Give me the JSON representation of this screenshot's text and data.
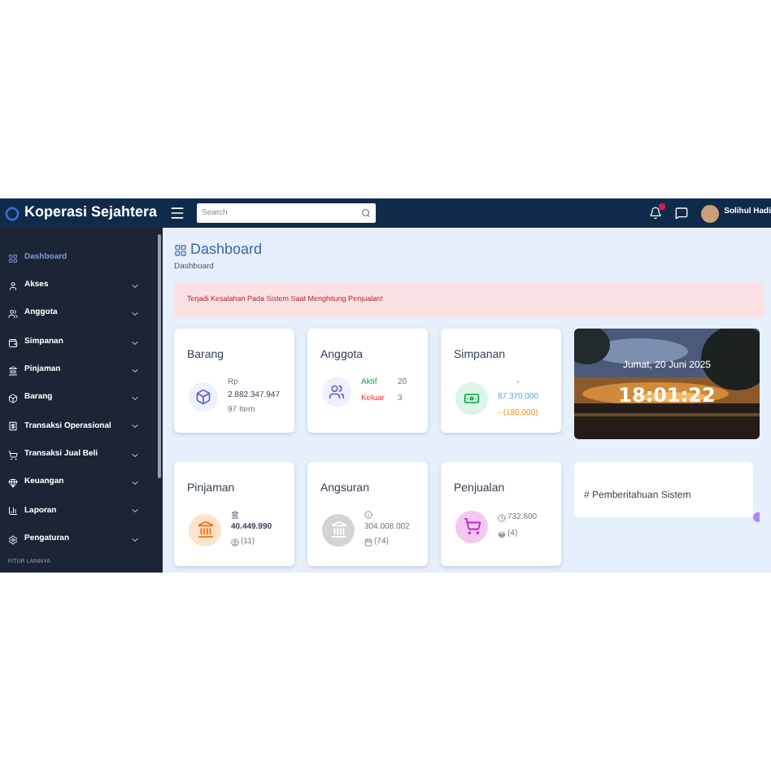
{
  "brand": "Koperasi Sejahtera",
  "search": {
    "placeholder": "Search"
  },
  "user": {
    "name": "Solihul Hadi"
  },
  "sidebar": {
    "items": [
      {
        "label": "Dashboard",
        "selected": true,
        "expandable": false
      },
      {
        "label": "Akses",
        "selected": false,
        "expandable": true
      },
      {
        "label": "Anggota",
        "selected": false,
        "expandable": true
      },
      {
        "label": "Simpanan",
        "selected": false,
        "expandable": true
      },
      {
        "label": "Pinjaman",
        "selected": false,
        "expandable": true
      },
      {
        "label": "Barang",
        "selected": false,
        "expandable": true
      },
      {
        "label": "Transaksi Operasional",
        "selected": false,
        "expandable": true
      },
      {
        "label": "Transaksi Jual Beli",
        "selected": false,
        "expandable": true
      },
      {
        "label": "Keuangan",
        "selected": false,
        "expandable": true
      },
      {
        "label": "Laporan",
        "selected": false,
        "expandable": true
      },
      {
        "label": "Pengaturan",
        "selected": false,
        "expandable": true
      }
    ],
    "section": "FITUR LAINNYA"
  },
  "page": {
    "title": "Dashboard",
    "breadcrumb": "Dashboard"
  },
  "alert": "Terjadi Kesalahan Pada Sistem Saat Menghitung Penjualan!",
  "cards": [
    {
      "title": "Barang",
      "kind": "barang",
      "lines": [
        "Rp",
        "2.882.347.947",
        "97 Item"
      ]
    },
    {
      "title": "Anggota",
      "kind": "anggota",
      "lines": [
        "Aktif",
        "20",
        "Keluar",
        "3"
      ]
    },
    {
      "title": "Simpanan",
      "kind": "simpanan",
      "lines": [
        "-",
        "87.370.000",
        "- (180.000)"
      ]
    },
    {
      "title": "Pinjaman",
      "kind": "pinjaman",
      "lines": [
        "40.449.990",
        "(11)"
      ]
    },
    {
      "title": "Angsuran",
      "kind": "angsuran",
      "lines": [
        "304.008.002",
        "(74)"
      ]
    },
    {
      "title": "Penjualan",
      "kind": "penjualan",
      "lines": [
        "732.600",
        "(4)"
      ]
    }
  ],
  "clock": {
    "date": "Jumat, 20 Juni 2025",
    "time": "18:01:22"
  },
  "notice": {
    "title": "# Pemberitahuan Sistem"
  }
}
